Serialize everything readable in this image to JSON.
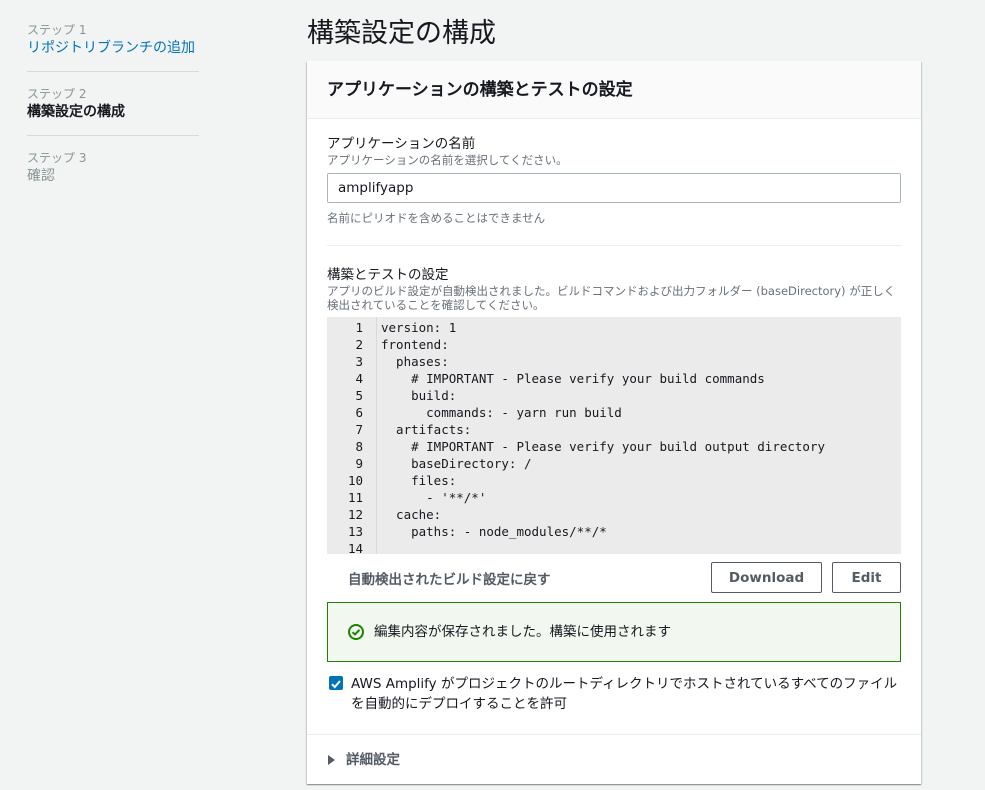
{
  "steps": [
    {
      "num": "ステップ 1",
      "label": "リポジトリブランチの追加",
      "state": "link"
    },
    {
      "num": "ステップ 2",
      "label": "構築設定の構成",
      "state": "active"
    },
    {
      "num": "ステップ 3",
      "label": "確認",
      "state": "disabled"
    }
  ],
  "page_title": "構築設定の構成",
  "card": {
    "title": "アプリケーションの構築とテストの設定",
    "app_name": {
      "label": "アプリケーションの名前",
      "description": "アプリケーションの名前を選択してください。",
      "value": "amplifyapp",
      "constraint": "名前にピリオドを含めることはできません"
    },
    "build": {
      "label": "構築とテストの設定",
      "description": "アプリのビルド設定が自動検出されました。ビルドコマンドおよび出力フォルダー (baseDirectory) が正しく検出されていることを確認してください。",
      "lines": [
        {
          "n": "1",
          "text": "version: 1"
        },
        {
          "n": "2",
          "text": "frontend:"
        },
        {
          "n": "3",
          "text": "  phases:"
        },
        {
          "n": "4",
          "text": "    # IMPORTANT - Please verify your build commands"
        },
        {
          "n": "5",
          "text": "    build:"
        },
        {
          "n": "6",
          "text": "      commands: - yarn run build"
        },
        {
          "n": "7",
          "text": "  artifacts:"
        },
        {
          "n": "8",
          "text": "    # IMPORTANT - Please verify your build output directory"
        },
        {
          "n": "9",
          "text": "    baseDirectory: /"
        },
        {
          "n": "10",
          "text": "    files:"
        },
        {
          "n": "11",
          "text": "      - '**/*'"
        },
        {
          "n": "12",
          "text": "  cache:"
        },
        {
          "n": "13",
          "text": "    paths: - node_modules/**/*"
        },
        {
          "n": "14",
          "text": ""
        }
      ],
      "revert_label": "自動検出されたビルド設定に戻す",
      "download_label": "Download",
      "edit_label": "Edit"
    },
    "alert": {
      "icon": "check-circle-icon",
      "text": "編集内容が保存されました。構築に使用されます",
      "color": "#1d8102"
    },
    "consent": {
      "checked": true,
      "text": "AWS Amplify がプロジェクトのルートディレクトリでホストされているすべてのファイルを自動的にデプロイすることを許可"
    },
    "advanced_label": "詳細設定"
  },
  "colors": {
    "link": "#0073bb",
    "success": "#1d8102",
    "checkbox": "#0073bb"
  }
}
